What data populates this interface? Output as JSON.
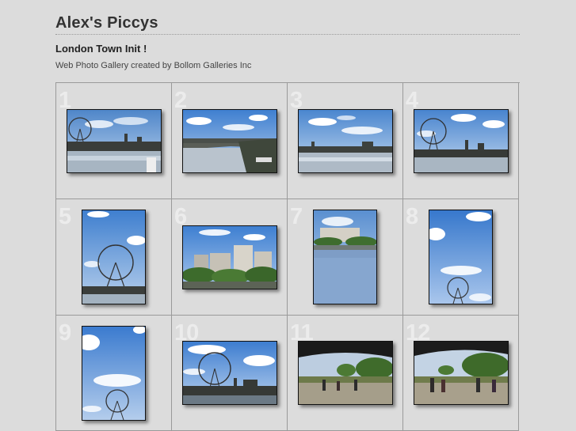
{
  "site_title": "Alex's Piccys",
  "gallery_title": "London Town Init !",
  "subtitle": "Web Photo Gallery created by Bollom Galleries Inc",
  "thumbnails": [
    {
      "number": "1",
      "orientation": "landscape"
    },
    {
      "number": "2",
      "orientation": "landscape"
    },
    {
      "number": "3",
      "orientation": "landscape"
    },
    {
      "number": "4",
      "orientation": "landscape"
    },
    {
      "number": "5",
      "orientation": "portrait"
    },
    {
      "number": "6",
      "orientation": "landscape"
    },
    {
      "number": "7",
      "orientation": "portrait"
    },
    {
      "number": "8",
      "orientation": "portrait"
    },
    {
      "number": "9",
      "orientation": "portrait"
    },
    {
      "number": "10",
      "orientation": "landscape"
    },
    {
      "number": "11",
      "orientation": "landscape"
    },
    {
      "number": "12",
      "orientation": "landscape"
    }
  ],
  "colors": {
    "background": "#dcdcdc",
    "grid_line": "#9a9a9a",
    "number_watermark": "#ececec",
    "sky": "#6fa3dc"
  }
}
